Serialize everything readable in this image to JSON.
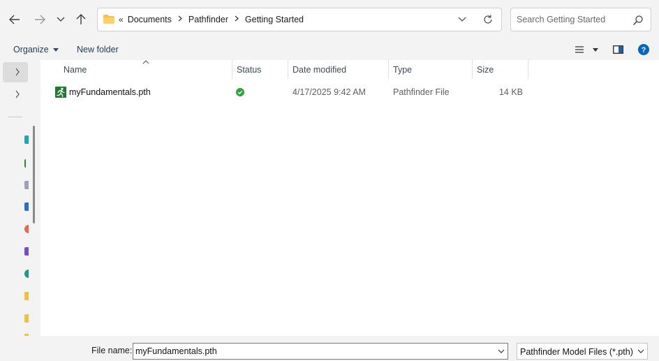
{
  "address": {
    "breadcrumbs": [
      "Documents",
      "Pathfinder",
      "Getting Started"
    ],
    "overflow_glyph": "«"
  },
  "search": {
    "placeholder": "Search Getting Started"
  },
  "commandbar": {
    "organize_label": "Organize",
    "new_folder_label": "New folder"
  },
  "columns": [
    "Name",
    "Status",
    "Date modified",
    "Type",
    "Size"
  ],
  "files": [
    {
      "name": "myFundamentals.pth",
      "status": "synced",
      "date_modified": "4/17/2025 9:42 AM",
      "type": "Pathfinder File",
      "size": "14 KB",
      "icon": "pathfinder-running-man-icon"
    }
  ],
  "bottom": {
    "file_name_label": "File name:",
    "file_name_value": "myFundamentals.pth",
    "filter_value": "Pathfinder Model Files (*.pth)"
  },
  "colors": {
    "accent_blue": "#0067c0",
    "status_green": "#2fa33c",
    "pathfinder_green": "#1f7a2c"
  }
}
